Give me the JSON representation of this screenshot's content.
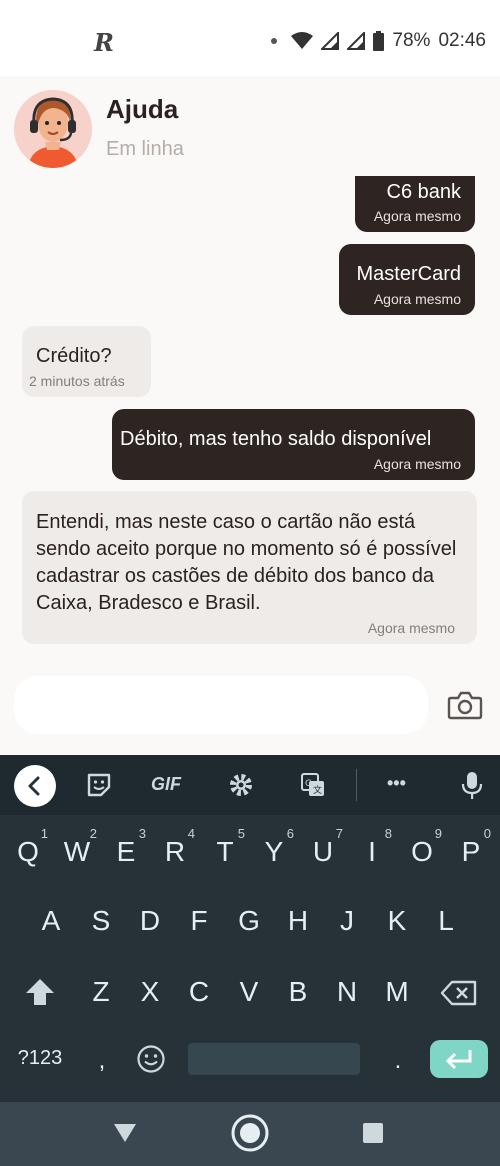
{
  "status_bar": {
    "carrier_logo": "R",
    "battery": "78%",
    "time": "02:46"
  },
  "chat_header": {
    "title": "Ajuda",
    "status": "Em linha"
  },
  "messages": [
    {
      "text": "C6 bank",
      "time": "Agora mesmo",
      "direction": "outgoing"
    },
    {
      "text": "MasterCard",
      "time": "Agora mesmo",
      "direction": "outgoing"
    },
    {
      "text": "Crédito?",
      "time": "2 minutos atrás",
      "direction": "incoming"
    },
    {
      "text": "Débito, mas tenho saldo disponível",
      "time": "Agora mesmo",
      "direction": "outgoing"
    },
    {
      "text": "Entendi, mas neste caso o cartão não está sendo aceito porque no momento só é possível cadastrar os castões de débito dos banco da Caixa, Bradesco e Brasil.",
      "time": "Agora mesmo",
      "direction": "incoming"
    }
  ],
  "composer": {
    "placeholder": "",
    "camera_icon": "camera-icon"
  },
  "keyboard": {
    "toolbar": {
      "gif_label": "GIF",
      "more_label": "•••"
    },
    "row1": [
      "Q",
      "W",
      "E",
      "R",
      "T",
      "Y",
      "U",
      "I",
      "O",
      "P"
    ],
    "row1_numbers": [
      "1",
      "2",
      "3",
      "4",
      "5",
      "6",
      "7",
      "8",
      "9",
      "0"
    ],
    "row2": [
      "A",
      "S",
      "D",
      "F",
      "G",
      "H",
      "J",
      "K",
      "L"
    ],
    "row3": [
      "Z",
      "X",
      "C",
      "V",
      "B",
      "N",
      "M"
    ],
    "bottom": {
      "symbols_label": "?123",
      "comma": ",",
      "period": "."
    }
  },
  "colors": {
    "outgoing_bubble": "#2e2422",
    "incoming_bubble": "#efebe8",
    "keyboard_bg": "#263238",
    "enter_key": "#7fd6c7"
  }
}
